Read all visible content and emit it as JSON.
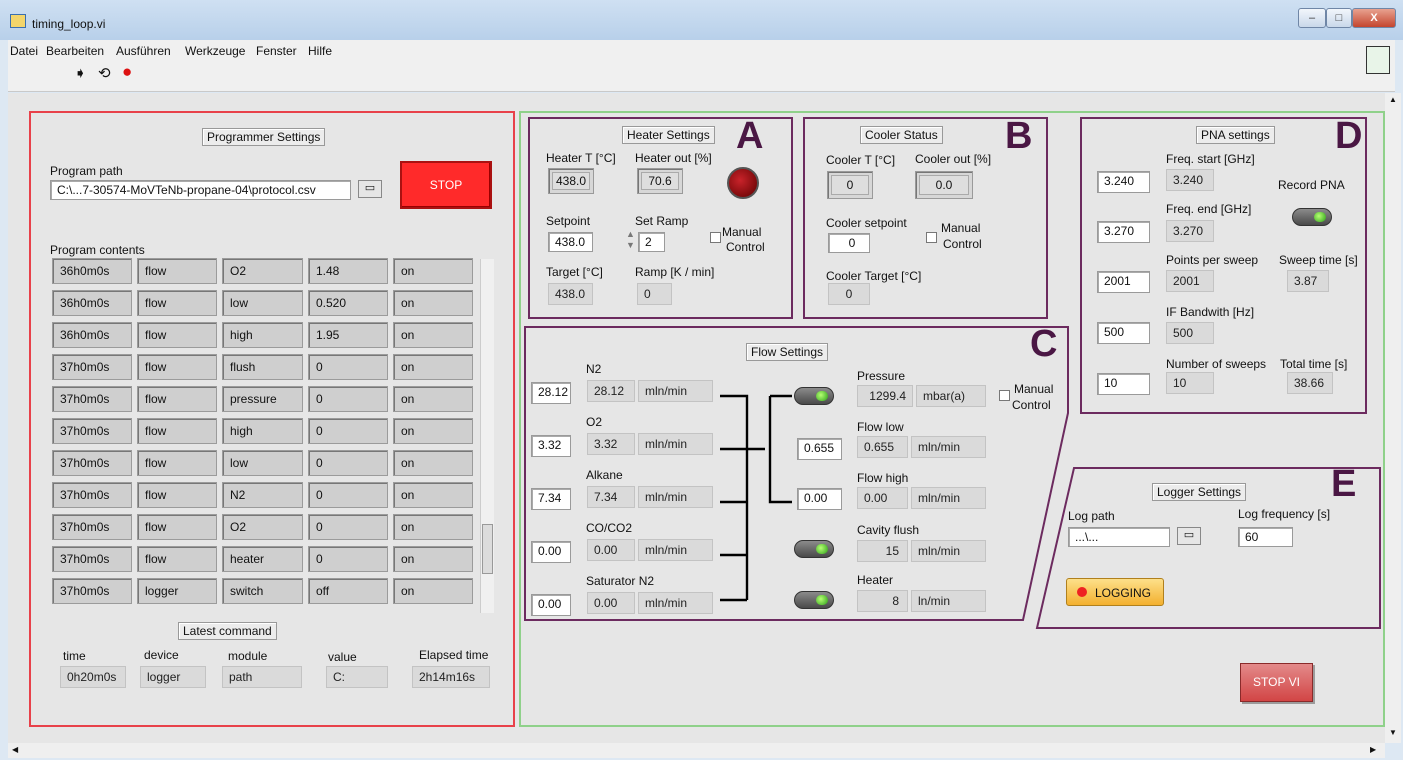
{
  "window": {
    "title": "timing_loop.vi",
    "min": "–",
    "max": "□",
    "close": "X"
  },
  "menu": [
    "Datei",
    "Bearbeiten",
    "Ausführen",
    "Werkzeuge",
    "Fenster",
    "Hilfe"
  ],
  "toolbar": {
    "run": "➧",
    "run_cont": "⟲",
    "abort": "●"
  },
  "colors": {
    "prog_border": "#e8414a",
    "main_border": "#8fd18a",
    "sub_border": "#6c2b5f"
  },
  "prog": {
    "title": "Programmer Settings",
    "path_label": "Program path",
    "path": "C:\\...7-30574-MoVTeNb-propane-04\\protocol.csv",
    "stop": "STOP",
    "contents_label": "Program contents",
    "rows": [
      [
        "36h0m0s",
        "flow",
        "O2",
        "1.48",
        "on"
      ],
      [
        "36h0m0s",
        "flow",
        "low",
        "0.520",
        "on"
      ],
      [
        "36h0m0s",
        "flow",
        "high",
        "1.95",
        "on"
      ],
      [
        "37h0m0s",
        "flow",
        "flush",
        "0",
        "on"
      ],
      [
        "37h0m0s",
        "flow",
        "pressure",
        "0",
        "on"
      ],
      [
        "37h0m0s",
        "flow",
        "high",
        "0",
        "on"
      ],
      [
        "37h0m0s",
        "flow",
        "low",
        "0",
        "on"
      ],
      [
        "37h0m0s",
        "flow",
        "N2",
        "0",
        "on"
      ],
      [
        "37h0m0s",
        "flow",
        "O2",
        "0",
        "on"
      ],
      [
        "37h0m0s",
        "flow",
        "heater",
        "0",
        "on"
      ],
      [
        "37h0m0s",
        "logger",
        "switch",
        "off",
        "on"
      ]
    ],
    "latest": "Latest command",
    "heads": [
      "time",
      "device",
      "module",
      "value",
      "Elapsed time"
    ],
    "vals": [
      "0h20m0s",
      "logger",
      "path",
      "C:",
      "2h14m16s"
    ]
  },
  "heater": {
    "title": "Heater Settings",
    "letter": "A",
    "t_label": "Heater T [°C]",
    "out_label": "Heater out [%]",
    "t": "438.0",
    "out": "70.6",
    "sp_label": "Setpoint",
    "ramp_label": "Set Ramp",
    "sp": "438.0",
    "ramp": "2",
    "manual": "Manual",
    "control": "Control",
    "target_label": "Target [°C]",
    "rampk_label": "Ramp [K / min]",
    "target": "438.0",
    "rampk": "0"
  },
  "cooler": {
    "title": "Cooler Status",
    "letter": "B",
    "t_label": "Cooler T [°C]",
    "out_label": "Cooler out [%]",
    "t": "0",
    "out": "0.0",
    "sp_label": "Cooler setpoint",
    "sp": "0",
    "manual": "Manual",
    "control": "Control",
    "target_label": "Cooler Target [°C]",
    "target": "0"
  },
  "flow": {
    "title": "Flow Settings",
    "letter": "C",
    "unit": "mln/min",
    "gases": [
      {
        "name": "N2",
        "set": "28.12",
        "act": "28.12"
      },
      {
        "name": "O2",
        "set": "3.32",
        "act": "3.32"
      },
      {
        "name": "Alkane",
        "set": "7.34",
        "act": "7.34"
      },
      {
        "name": "CO/CO2",
        "set": "0.00",
        "act": "0.00"
      },
      {
        "name": "Saturator N2",
        "set": "0.00",
        "act": "0.00"
      }
    ],
    "pressure_label": "Pressure",
    "pressure": "1299.4",
    "pressure_unit": "mbar(a)",
    "low_label": "Flow low",
    "low_set": "0.655",
    "low": "0.655",
    "high_label": "Flow high",
    "high_set": "0.00",
    "high": "0.00",
    "flush_label": "Cavity flush",
    "flush": "15",
    "heater_label": "Heater",
    "heater": "8",
    "heater_unit": "ln/min",
    "manual": "Manual",
    "control": "Control"
  },
  "pna": {
    "title": "PNA settings",
    "letter": "D",
    "fs_label": "Freq. start [GHz]",
    "fs_set": "3.240",
    "fs": "3.240",
    "fe_label": "Freq. end [GHz]",
    "fe_set": "3.270",
    "fe": "3.270",
    "pps_label": "Points per sweep",
    "pps_set": "2001",
    "pps": "2001",
    "ifb_label": "IF Bandwith [Hz]",
    "ifb_set": "500",
    "ifb": "500",
    "ns_label": "Number of sweeps",
    "ns_set": "10",
    "ns": "10",
    "record": "Record PNA",
    "sweep_label": "Sweep time [s]",
    "sweep": "3.87",
    "total_label": "Total time [s]",
    "total": "38.66"
  },
  "logger": {
    "title": "Logger Settings",
    "letter": "E",
    "path_label": "Log path",
    "path": "...\\...",
    "freq_label": "Log frequency [s]",
    "freq": "60",
    "logging": "LOGGING"
  },
  "stopvi": "STOP VI"
}
